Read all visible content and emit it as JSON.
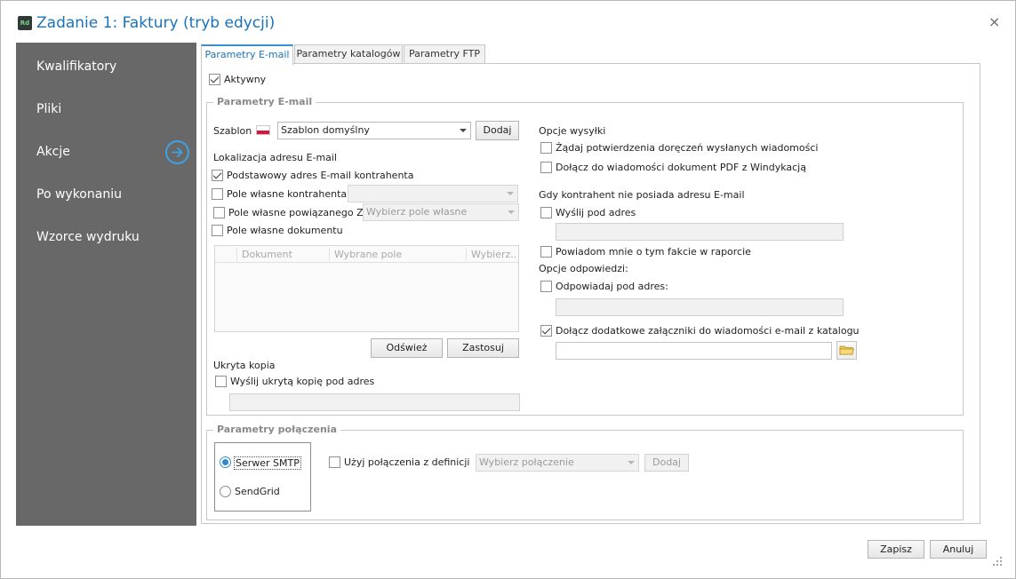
{
  "window": {
    "app_icon_text": "Rd",
    "title": "Zadanie 1: Faktury (tryb edycji)",
    "close_glyph": "×"
  },
  "sidebar": {
    "items": [
      {
        "label": "Kwalifikatory"
      },
      {
        "label": "Pliki"
      },
      {
        "label": "Akcje",
        "active": true,
        "icon": "arrow-right-circle-icon"
      },
      {
        "label": "Po wykonaniu"
      },
      {
        "label": "Wzorce wydruku"
      }
    ],
    "accent_color": "#3fa2e4",
    "background_color": "#686868"
  },
  "tabs": [
    {
      "label": "Parametry E-mail",
      "active": true
    },
    {
      "label": "Parametry katalogów"
    },
    {
      "label": "Parametry FTP"
    }
  ],
  "active_checkbox": {
    "label": "Aktywny",
    "checked": true
  },
  "email_params": {
    "group_title": "Parametry E-mail",
    "template": {
      "label": "Szablon",
      "flag": "flag-pl-icon",
      "value": "Szablon domyślny",
      "add_button": "Dodaj"
    },
    "address_location": {
      "title": "Lokalizacja adresu E-mail",
      "basic_address": {
        "label": "Podstawowy adres E-mail kontrahenta",
        "checked": true
      },
      "custom_field_contractor": {
        "label": "Pole własne kontrahenta",
        "checked": false,
        "select_value": ""
      },
      "custom_field_linked": {
        "label": "Pole własne powiązanego ZK",
        "checked": false,
        "select_placeholder": "Wybierz pole własne"
      },
      "custom_field_document": {
        "label": "Pole własne dokumentu",
        "checked": false
      },
      "grid_columns": [
        "Dokument",
        "Wybrane pole",
        "Wybierz..."
      ],
      "refresh_button": "Odśwież",
      "apply_button": "Zastosuj"
    },
    "bcc": {
      "title": "Ukryta kopia",
      "checkbox": {
        "label": "Wyślij ukrytą kopię pod adres",
        "checked": false
      },
      "value": ""
    },
    "send_options": {
      "title": "Opcje wysyłki",
      "delivery_confirmation": {
        "label": "Żądaj potwierdzenia doręczeń wysłanych wiadomości",
        "checked": false
      },
      "attach_pdf": {
        "label": "Dołącz do wiadomości dokument PDF z Windykacją",
        "checked": false
      }
    },
    "no_address": {
      "title": "Gdy kontrahent nie posiada adresu E-mail",
      "send_to": {
        "label": "Wyślij pod adres",
        "checked": false,
        "value": ""
      },
      "notify_me": {
        "label": "Powiadom mnie o tym fakcie w raporcie",
        "checked": false
      }
    },
    "reply_options": {
      "title": "Opcje odpowiedzi:",
      "reply_to": {
        "label": "Odpowiadaj pod adres:",
        "checked": false,
        "value": ""
      },
      "attach_extra": {
        "label": "Dołącz dodatkowe załączniki do wiadomości e-mail  z katalogu",
        "checked": true,
        "value": ""
      }
    }
  },
  "connection_params": {
    "group_title": "Parametry połączenia",
    "smtp": {
      "label": "Serwer SMTP",
      "selected": true
    },
    "sendgrid": {
      "label": "SendGrid",
      "selected": false
    },
    "use_definition": {
      "label": "Użyj połączenia z definicji",
      "checked": false
    },
    "connection_select_placeholder": "Wybierz połączenie",
    "add_button": "Dodaj"
  },
  "footer": {
    "save_button": "Zapisz",
    "cancel_button": "Anuluj"
  }
}
